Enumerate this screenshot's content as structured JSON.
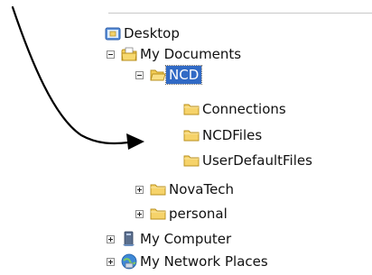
{
  "tree": {
    "desktop": {
      "label": "Desktop",
      "icon": "desktop-icon"
    },
    "my_documents": {
      "label": "My Documents",
      "icon": "my-documents-folder-icon",
      "expanded": true
    },
    "ncd": {
      "label": "NCD",
      "icon": "open-folder-icon",
      "expanded": true,
      "selected": true
    },
    "connections": {
      "label": "Connections",
      "icon": "folder-icon"
    },
    "ncdfiles": {
      "label": "NCDFiles",
      "icon": "folder-icon"
    },
    "userdefaultfiles": {
      "label": "UserDefaultFiles",
      "icon": "folder-icon"
    },
    "novatech": {
      "label": "NovaTech",
      "icon": "folder-icon",
      "expanded": false
    },
    "personal": {
      "label": "personal",
      "icon": "folder-icon",
      "expanded": false
    },
    "my_computer": {
      "label": "My Computer",
      "icon": "my-computer-icon",
      "expanded": false
    },
    "my_network_places": {
      "label": "My Network Places",
      "icon": "my-network-places-icon",
      "expanded": false
    }
  },
  "colors": {
    "selection": "#316ac5",
    "folder": "#f2c94c",
    "arrow": "#000000"
  }
}
